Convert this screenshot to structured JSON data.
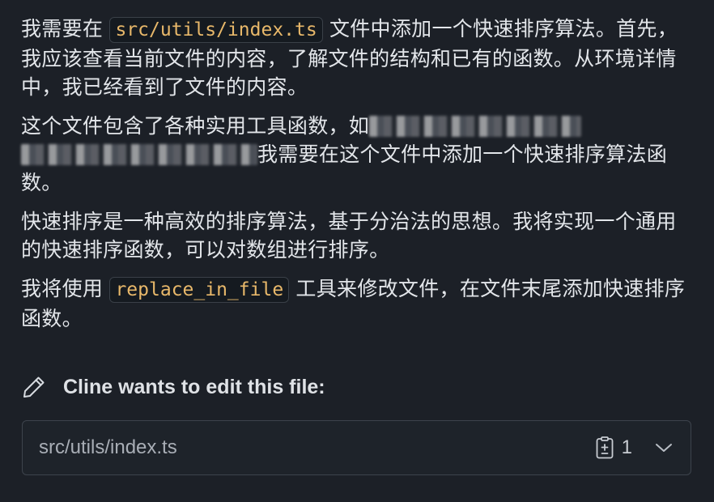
{
  "message": {
    "p1_a": "我需要在",
    "p1_code": "src/utils/index.ts",
    "p1_b": "文件中添加一个快速排序算法。首先，我应该查看当前文件的内容，了解文件的结构和已有的函数。从环境详情中，我已经看到了文件的内容。",
    "p2_a": "这个文件包含了各种实用工具函数，如",
    "p2_b": "我需要在这个文件中添加一个快速排序算法函数。",
    "p3": "快速排序是一种高效的排序算法，基于分治法的思想。我将实现一个通用的快速排序函数，可以对数组进行排序。",
    "p4_a": "我将使用",
    "p4_code": "replace_in_file",
    "p4_b": "工具来修改文件，在文件末尾添加快速排序函数。"
  },
  "edit": {
    "header": "Cline wants to edit this file:",
    "file_path": "src/utils/index.ts",
    "diff_count": "1",
    "icons": {
      "header": "pencil-icon",
      "diff": "diff-icon",
      "expand": "chevron-down-icon"
    }
  },
  "colors": {
    "background": "#1c2027",
    "text": "#e3e6ea",
    "code_text": "#e8b86a",
    "border": "#3d434c"
  }
}
